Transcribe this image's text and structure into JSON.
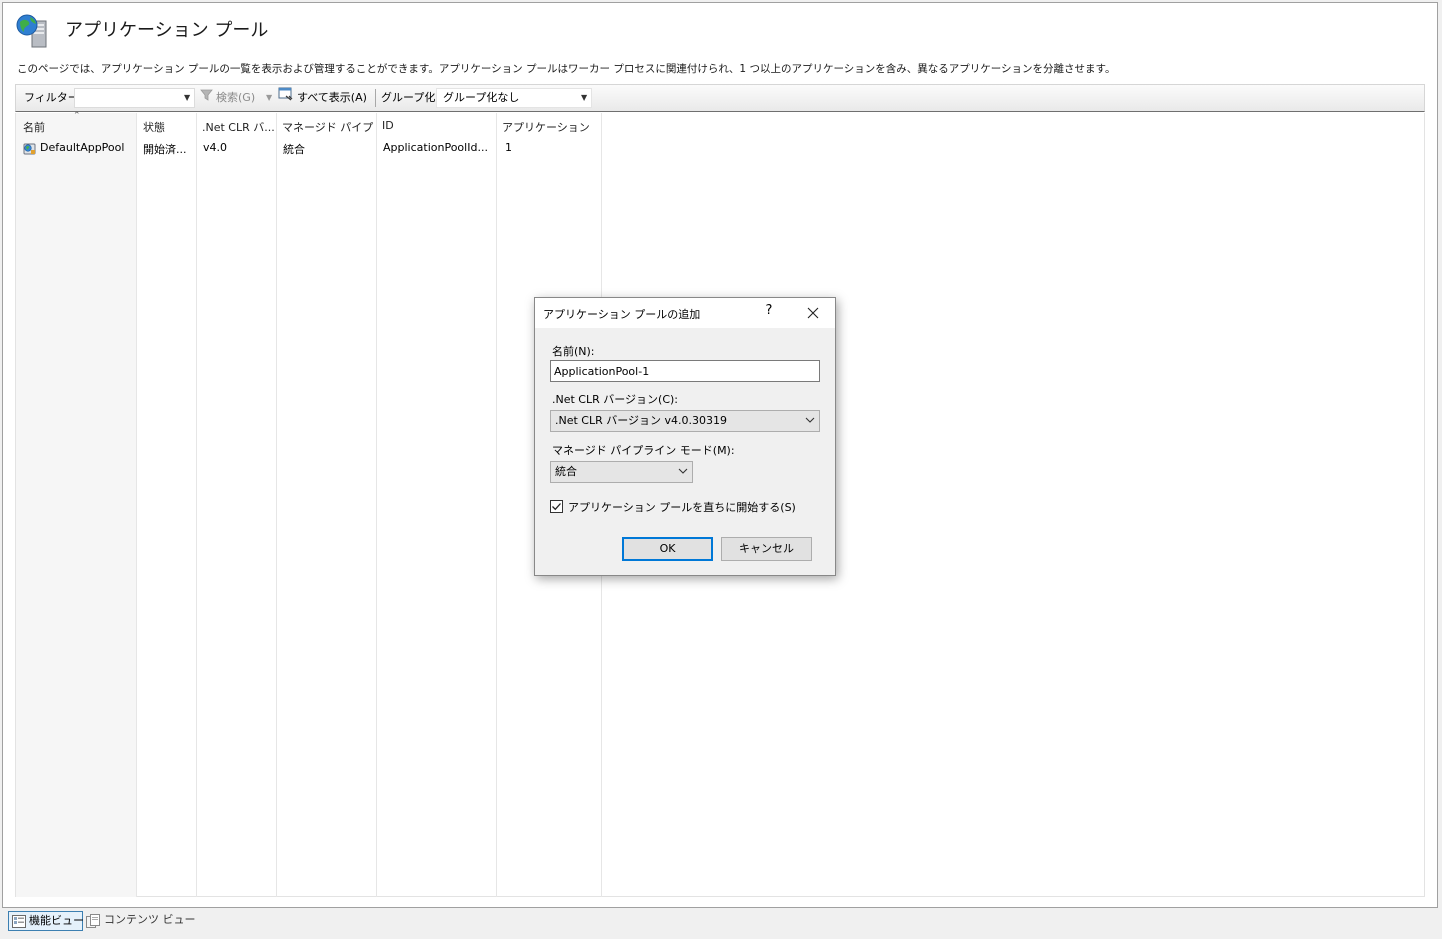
{
  "page": {
    "title": "アプリケーション プール",
    "description": "このページでは、アプリケーション プールの一覧を表示および管理することができます。アプリケーション プールはワーカー プロセスに関連付けられ、1 つ以上のアプリケーションを含み、異なるアプリケーションを分離させます。"
  },
  "toolbar": {
    "filter_label": "フィルター:",
    "filter_value": "",
    "search_label": "検索(G)",
    "showall_label": "すべて表示(A)",
    "group_label": "グループ化:",
    "group_value": "グループ化なし"
  },
  "table": {
    "columns": [
      "名前",
      "状態",
      ".Net CLR バ...",
      "マネージド パイプ...",
      "ID",
      "アプリケーション"
    ],
    "rows": [
      [
        "DefaultAppPool",
        "開始済...",
        "v4.0",
        "統合",
        "ApplicationPoolId...",
        "1"
      ]
    ]
  },
  "views": {
    "feature_view": "機能ビュー",
    "content_view": "コンテンツ ビュー"
  },
  "dialog": {
    "title": "アプリケーション プールの追加",
    "help": "?",
    "name_label": "名前(N):",
    "name_value": "ApplicationPool-1",
    "clr_label": ".Net CLR バージョン(C):",
    "clr_value": ".Net CLR バージョン v4.0.30319",
    "mode_label": "マネージド パイプライン モード(M):",
    "mode_value": "統合",
    "start_label": "アプリケーション プールを直ちに開始する(S)",
    "start_checked": true,
    "ok_label": "OK",
    "cancel_label": "キャンセル"
  },
  "colors": {
    "accent": "#0078d7",
    "window_bg": "#f0f0f0"
  },
  "icons": [
    "app-pools-icon",
    "filter-funnel-icon",
    "show-all-icon",
    "app-pool-icon",
    "feature-view-icon",
    "content-view-icon",
    "close-icon",
    "chevron-down-icon",
    "checkmark-icon"
  ]
}
